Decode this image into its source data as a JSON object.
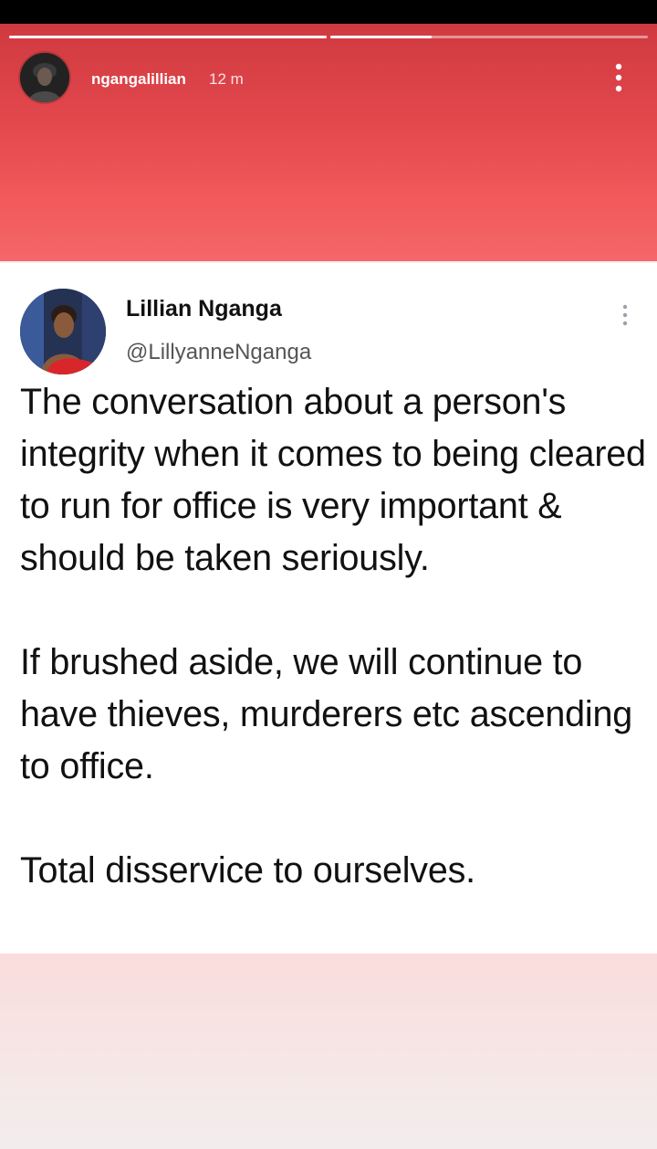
{
  "story": {
    "username": "ngangalillian",
    "time": "12 m",
    "progress": [
      1.0,
      0.32
    ]
  },
  "tweet": {
    "name": "Lillian Nganga",
    "handle": "@LillyanneNganga",
    "paragraphs": [
      "The conversation about a person's integrity when it comes to being cleared to run for office is very important & should be taken seriously.",
      "If brushed aside, we will continue to have thieves, murderers etc ascending to office.",
      "Total disservice to ourselves."
    ]
  },
  "colors": {
    "story_red": "#e2474c",
    "story_pink": "#fadcdc"
  }
}
